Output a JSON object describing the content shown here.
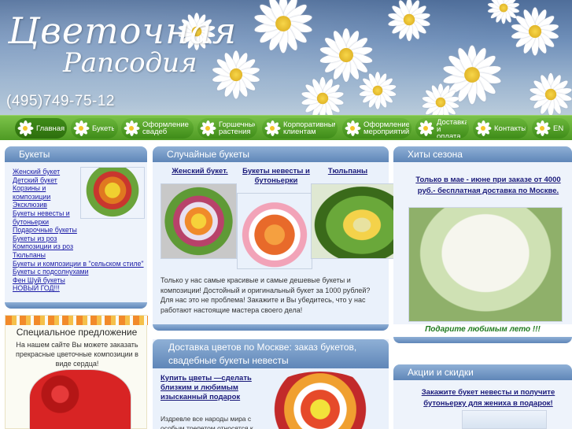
{
  "header": {
    "logo_line1": "Цветочная",
    "logo_line2": "Рапсодия",
    "phone": "(495)749-75-12"
  },
  "nav": {
    "items": [
      {
        "label": "Главная",
        "active": true
      },
      {
        "label": "Букеты"
      },
      {
        "label": "Оформление свадеб"
      },
      {
        "label": "Горшечные растения"
      },
      {
        "label": "Корпоративным клиентам"
      },
      {
        "label": "Оформление мероприятий"
      },
      {
        "label": "Доставка и оплата"
      },
      {
        "label": "Контакты"
      },
      {
        "label": "EN"
      }
    ]
  },
  "left": {
    "title": "Букеты",
    "categories": [
      "Женский букет",
      "Детский букет",
      "Корзины и композиции",
      "Эксклюзив",
      "Букеты невесты и бутоньерки",
      "Подарочные букеты",
      "Букеты из роз",
      "Композиции из роз",
      "Тюльпаны",
      "Букеты и композиции в \"сельском стиле\"",
      "Букеты с подсолнухами",
      "Фен Шуй букеты",
      "НОВЫЙ ГОД!!!"
    ],
    "special_title": "Специальное предложение",
    "special_text": "На нашем сайте Вы можете заказать прекрасные цветочные композиции в виде сердца!"
  },
  "center": {
    "title": "Случайные букеты",
    "links": [
      "Женский букет.",
      "Букеты невесты и бутоньерки",
      "Тюльпаны"
    ],
    "text": "Только у нас самые красивые и самые дешевые букеты и композиции! Достойный и оригинальный  букет за  1000 рублей? Для нас это не проблема! Закажите и Вы убедитесь, что у нас работают настоящие мастера своего дела!",
    "title2": "Доставка цветов по Москве: заказ букетов, свадебные букеты невесты",
    "buy_link": "Купить цветы  —сделать близким и любимым изысканный подарок",
    "text2": "Издревле все народы мира с особым трепетом относятся к"
  },
  "right": {
    "title": "Хиты сезона",
    "hit_link": "Только в мае - июне при заказе от 4000 руб.- бесплатная доставка по Москве.",
    "caption": "Подарите любимым лето !!!",
    "title2": "Акции и скидки",
    "promo_link": "Закажите букет невесты и получите бутоньерку для жениха в подарок!"
  },
  "colors": {
    "nav_green": "#4e9a23",
    "panel_blue": "#5f86b8",
    "link_blue": "#1a1aa6",
    "caption_green": "#1f7a1f"
  }
}
